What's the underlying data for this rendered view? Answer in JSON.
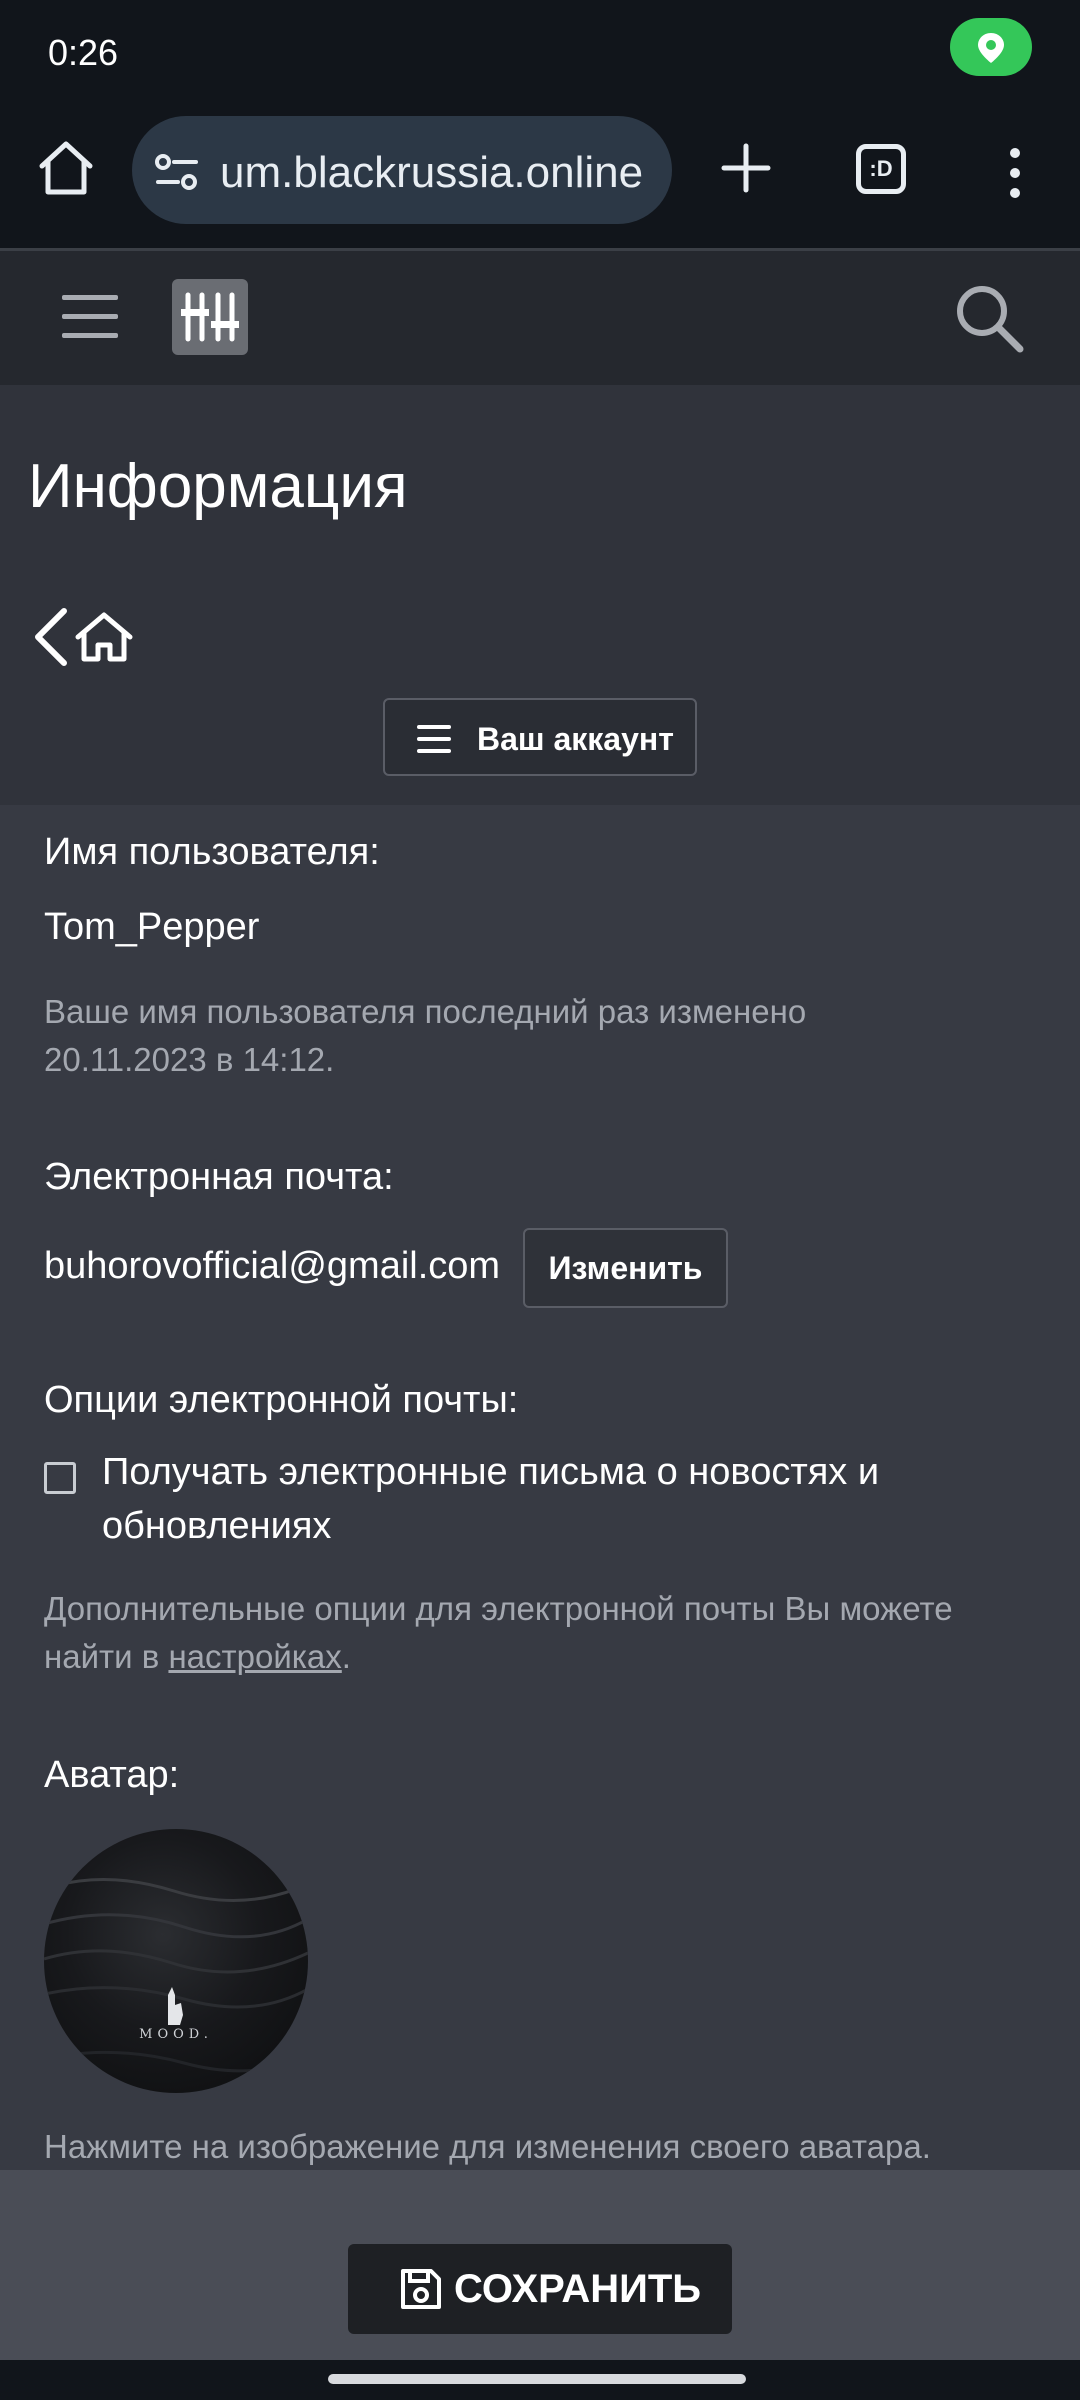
{
  "status_bar": {
    "time": "0:26",
    "location_icon": "location-pin-icon",
    "pill_color": "#34c759"
  },
  "browser": {
    "url": "um.blackrussia.online",
    "tabs_count": ":D",
    "icons": [
      "home-icon",
      "site-settings-icon",
      "plus-icon",
      "tabs-icon",
      "more-vert-icon"
    ]
  },
  "site_header": {
    "icons": [
      "hamburger-icon",
      "logo-icon",
      "search-icon"
    ]
  },
  "page": {
    "title": "Информация",
    "account_menu_label": "Ваш аккаунт"
  },
  "form": {
    "username_label": "Имя пользователя:",
    "username_value": "Tom_Pepper",
    "username_hint": "Ваше имя пользователя последний раз изменено 20.11.2023 в 14:12.",
    "email_label": "Электронная почта:",
    "email_value": "buhorovofficial@gmail.com",
    "change_button": "Изменить",
    "email_options_label": "Опции электронной почты:",
    "newsletter_checkbox_label": "Получать электронные письма о новостях и обновлениях",
    "newsletter_checked": false,
    "email_options_hint_prefix": "Дополнительные опции для электронной почты Вы можете найти в ",
    "email_options_hint_link": "настройках",
    "email_options_hint_suffix": ".",
    "avatar_label": "Аватар:",
    "avatar_image_text": "MOOD.",
    "avatar_hint": "Нажмите на изображение для изменения своего аватара."
  },
  "actions": {
    "save_label": "СОХРАНИТЬ"
  }
}
